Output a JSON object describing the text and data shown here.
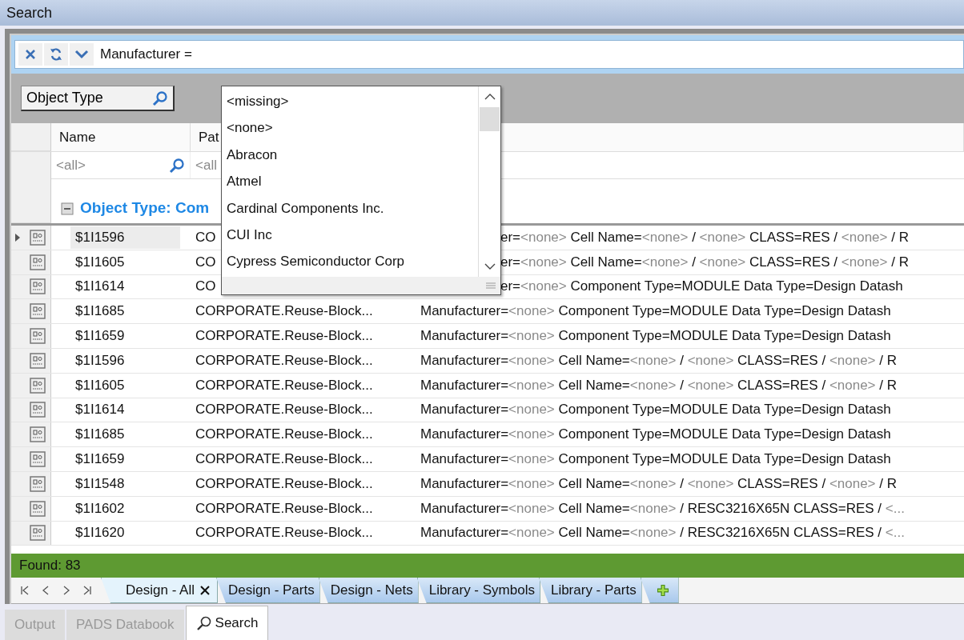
{
  "window": {
    "title": "Search"
  },
  "filter_bar": {
    "value": "Manufacturer ="
  },
  "group_by": {
    "label": "Object Type"
  },
  "table": {
    "columns": [
      "Name",
      "Pat"
    ],
    "filters": [
      "<all>",
      "<all"
    ],
    "group": {
      "label": "Object Type: Com",
      "expanded": true
    },
    "rows": [
      {
        "selected": true,
        "clipped": true,
        "name": "$1I1596",
        "path": "CO",
        "props": [
          {
            "t": "er=",
            "dim": false
          },
          {
            "t": "<none>",
            "dim": true
          },
          {
            "t": " Cell Name=",
            "dim": false
          },
          {
            "t": "<none>",
            "dim": true
          },
          {
            "t": " / ",
            "dim": false
          },
          {
            "t": "<none>",
            "dim": true
          },
          {
            "t": " CLASS=RES / ",
            "dim": false
          },
          {
            "t": "<none>",
            "dim": true
          },
          {
            "t": " / R",
            "dim": false
          }
        ]
      },
      {
        "selected": false,
        "clipped": true,
        "name": "$1I1605",
        "path": "CO",
        "props": [
          {
            "t": "er=",
            "dim": false
          },
          {
            "t": "<none>",
            "dim": true
          },
          {
            "t": " Cell Name=",
            "dim": false
          },
          {
            "t": "<none>",
            "dim": true
          },
          {
            "t": " / ",
            "dim": false
          },
          {
            "t": "<none>",
            "dim": true
          },
          {
            "t": " CLASS=RES / ",
            "dim": false
          },
          {
            "t": "<none>",
            "dim": true
          },
          {
            "t": " / R",
            "dim": false
          }
        ]
      },
      {
        "selected": false,
        "clipped": true,
        "name": "$1I1614",
        "path": "CO",
        "props": [
          {
            "t": "er=",
            "dim": false
          },
          {
            "t": "<none>",
            "dim": true
          },
          {
            "t": " Component Type=MODULE Data Type=Design Datash",
            "dim": false
          }
        ]
      },
      {
        "selected": false,
        "clipped": false,
        "name": "$1I1685",
        "path": "CORPORATE.Reuse-Block...",
        "props": [
          {
            "t": "Manufacturer=",
            "dim": false
          },
          {
            "t": "<none>",
            "dim": true
          },
          {
            "t": " Component Type=MODULE Data Type=Design Datash",
            "dim": false
          }
        ]
      },
      {
        "selected": false,
        "clipped": false,
        "name": "$1I1659",
        "path": "CORPORATE.Reuse-Block...",
        "props": [
          {
            "t": "Manufacturer=",
            "dim": false
          },
          {
            "t": "<none>",
            "dim": true
          },
          {
            "t": " Component Type=MODULE Data Type=Design Datash",
            "dim": false
          }
        ]
      },
      {
        "selected": false,
        "clipped": false,
        "name": "$1I1596",
        "path": "CORPORATE.Reuse-Block...",
        "props": [
          {
            "t": "Manufacturer=",
            "dim": false
          },
          {
            "t": "<none>",
            "dim": true
          },
          {
            "t": " Cell Name=",
            "dim": false
          },
          {
            "t": "<none>",
            "dim": true
          },
          {
            "t": " / ",
            "dim": false
          },
          {
            "t": "<none>",
            "dim": true
          },
          {
            "t": " CLASS=RES / ",
            "dim": false
          },
          {
            "t": "<none>",
            "dim": true
          },
          {
            "t": " / R",
            "dim": false
          }
        ]
      },
      {
        "selected": false,
        "clipped": false,
        "name": "$1I1605",
        "path": "CORPORATE.Reuse-Block...",
        "props": [
          {
            "t": "Manufacturer=",
            "dim": false
          },
          {
            "t": "<none>",
            "dim": true
          },
          {
            "t": " Cell Name=",
            "dim": false
          },
          {
            "t": "<none>",
            "dim": true
          },
          {
            "t": " / ",
            "dim": false
          },
          {
            "t": "<none>",
            "dim": true
          },
          {
            "t": " CLASS=RES / ",
            "dim": false
          },
          {
            "t": "<none>",
            "dim": true
          },
          {
            "t": " / R",
            "dim": false
          }
        ]
      },
      {
        "selected": false,
        "clipped": false,
        "name": "$1I1614",
        "path": "CORPORATE.Reuse-Block...",
        "props": [
          {
            "t": "Manufacturer=",
            "dim": false
          },
          {
            "t": "<none>",
            "dim": true
          },
          {
            "t": " Component Type=MODULE Data Type=Design Datash",
            "dim": false
          }
        ]
      },
      {
        "selected": false,
        "clipped": false,
        "name": "$1I1685",
        "path": "CORPORATE.Reuse-Block...",
        "props": [
          {
            "t": "Manufacturer=",
            "dim": false
          },
          {
            "t": "<none>",
            "dim": true
          },
          {
            "t": " Component Type=MODULE Data Type=Design Datash",
            "dim": false
          }
        ]
      },
      {
        "selected": false,
        "clipped": false,
        "name": "$1I1659",
        "path": "CORPORATE.Reuse-Block...",
        "props": [
          {
            "t": "Manufacturer=",
            "dim": false
          },
          {
            "t": "<none>",
            "dim": true
          },
          {
            "t": " Component Type=MODULE Data Type=Design Datash",
            "dim": false
          }
        ]
      },
      {
        "selected": false,
        "clipped": false,
        "name": "$1I1548",
        "path": "CORPORATE.Reuse-Block...",
        "props": [
          {
            "t": "Manufacturer=",
            "dim": false
          },
          {
            "t": "<none>",
            "dim": true
          },
          {
            "t": " Cell Name=",
            "dim": false
          },
          {
            "t": "<none>",
            "dim": true
          },
          {
            "t": " / ",
            "dim": false
          },
          {
            "t": "<none>",
            "dim": true
          },
          {
            "t": " CLASS=RES / ",
            "dim": false
          },
          {
            "t": "<none>",
            "dim": true
          },
          {
            "t": " / R",
            "dim": false
          }
        ]
      },
      {
        "selected": false,
        "clipped": false,
        "name": "$1I1602",
        "path": "CORPORATE.Reuse-Block...",
        "props": [
          {
            "t": "Manufacturer=",
            "dim": false
          },
          {
            "t": "<none>",
            "dim": true
          },
          {
            "t": " Cell Name=",
            "dim": false
          },
          {
            "t": "<none>",
            "dim": true
          },
          {
            "t": " / RESC3216X65N CLASS=RES / ",
            "dim": false
          },
          {
            "t": "<...",
            "dim": true
          }
        ]
      },
      {
        "selected": false,
        "clipped": false,
        "name": "$1I1620",
        "path": "CORPORATE.Reuse-Block...",
        "props": [
          {
            "t": "Manufacturer=",
            "dim": false
          },
          {
            "t": "<none>",
            "dim": true
          },
          {
            "t": " Cell Name=",
            "dim": false
          },
          {
            "t": "<none>",
            "dim": true
          },
          {
            "t": " / RESC3216X65N CLASS=RES / ",
            "dim": false
          },
          {
            "t": "<...",
            "dim": true
          }
        ]
      }
    ]
  },
  "dropdown": {
    "items": [
      {
        "label": "<missing>",
        "selected": false
      },
      {
        "label": "<none>",
        "selected": false
      },
      {
        "label": "Abracon",
        "selected": false
      },
      {
        "label": "Atmel",
        "selected": false
      },
      {
        "label": "Cardinal Components Inc.",
        "selected": false
      },
      {
        "label": "CUI Inc",
        "selected": false
      },
      {
        "label": "Cypress Semiconductor Corp",
        "selected": false
      }
    ]
  },
  "status": {
    "text": "Found: 83"
  },
  "tabs": [
    {
      "label": "Design - All",
      "selected": true
    },
    {
      "label": "Design - Parts",
      "selected": false
    },
    {
      "label": "Design - Nets",
      "selected": false
    },
    {
      "label": "Library - Symbols",
      "selected": false
    },
    {
      "label": "Library - Parts",
      "selected": false
    }
  ],
  "panel_tabs": [
    {
      "label": "Output",
      "selected": false
    },
    {
      "label": "PADS Databook",
      "selected": false
    },
    {
      "label": "Search",
      "selected": true
    }
  ]
}
